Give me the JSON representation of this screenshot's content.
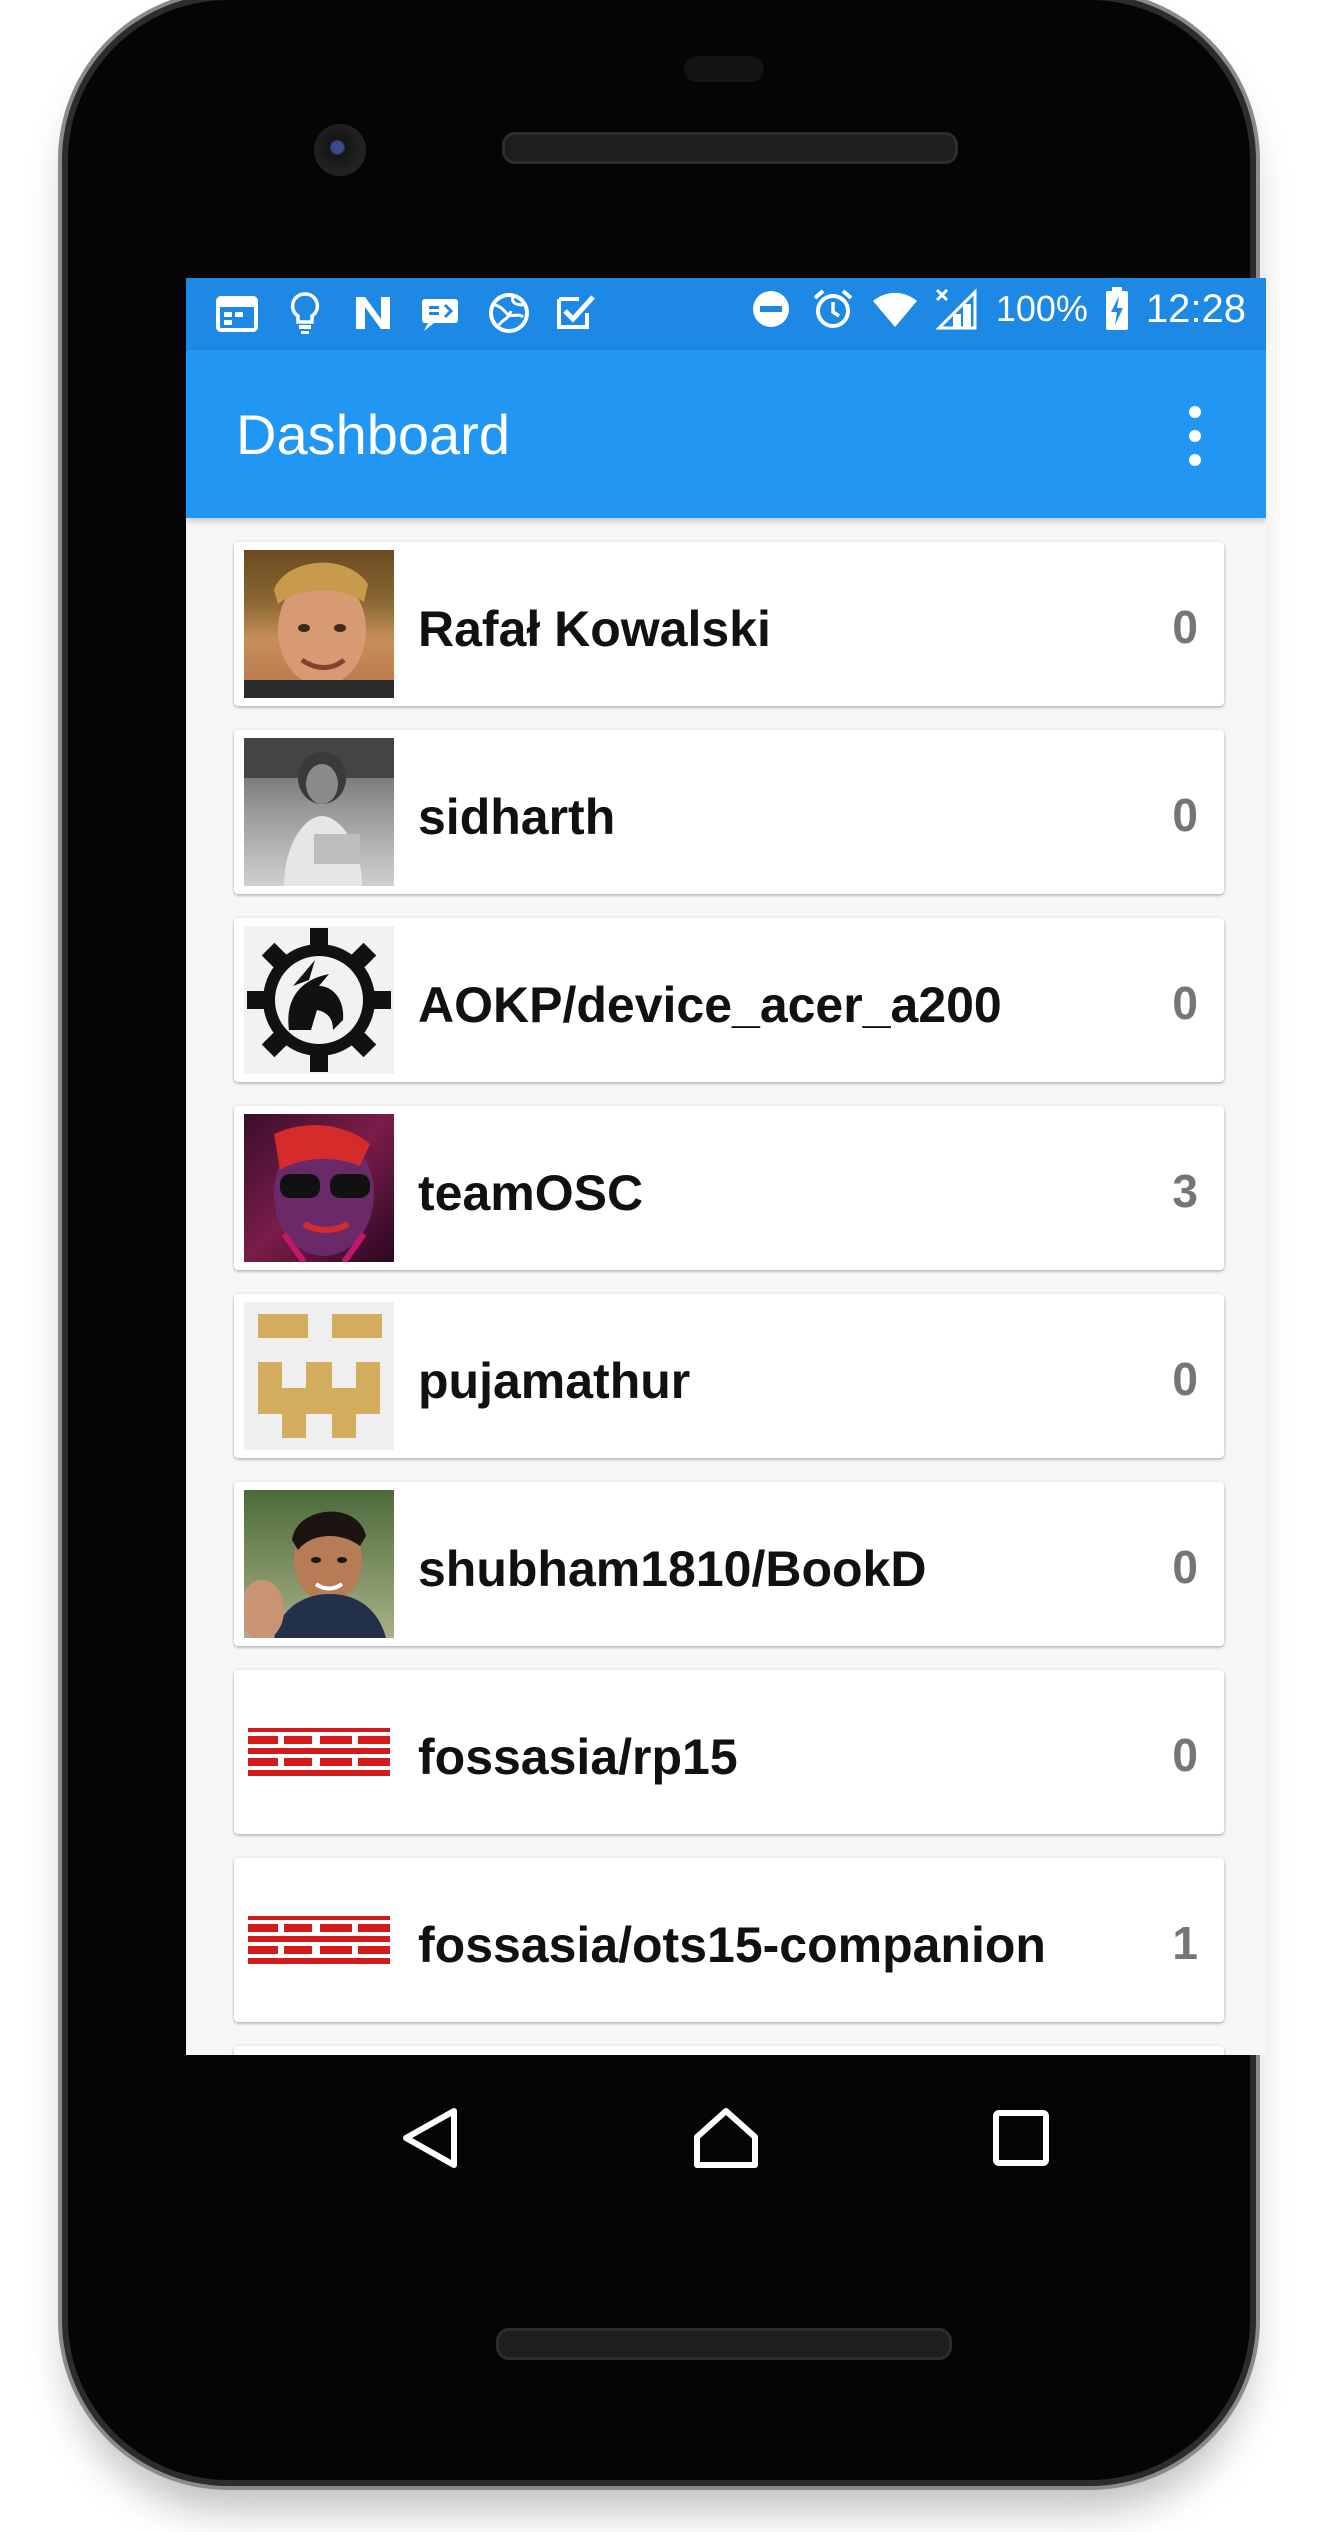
{
  "status_bar": {
    "battery": "100%",
    "time": "12:28",
    "left_icons": [
      "calendar-icon",
      "lightbulb-icon",
      "n-app-icon",
      "message-icon",
      "globe-icon",
      "checkbox-icon"
    ],
    "right_icons": [
      "do-not-disturb-icon",
      "alarm-icon",
      "wifi-icon",
      "signal-icon",
      "battery-charging-icon"
    ]
  },
  "app_bar": {
    "title": "Dashboard",
    "color": "#2196f3"
  },
  "repos": [
    {
      "name": "Rafał Kowalski",
      "count": "0",
      "avatar": "person-photo"
    },
    {
      "name": "sidharth",
      "count": "0",
      "avatar": "person-photo-bw"
    },
    {
      "name": "AOKP/device_acer_a200",
      "count": "0",
      "avatar": "aokp-unicorn-gear-logo"
    },
    {
      "name": "teamOSC",
      "count": "3",
      "avatar": "purple-red-face"
    },
    {
      "name": "pujamathur",
      "count": "0",
      "avatar": "gold-identicon"
    },
    {
      "name": "shubham1810/BookD",
      "count": "0",
      "avatar": "person-photo"
    },
    {
      "name": "fossasia/rp15",
      "count": "0",
      "avatar": "fossasia-logo"
    },
    {
      "name": "fossasia/ots15-companion",
      "count": "1",
      "avatar": "fossasia-logo"
    }
  ],
  "nav_bar": {
    "icons": [
      "back-icon",
      "home-icon",
      "recents-icon"
    ]
  }
}
